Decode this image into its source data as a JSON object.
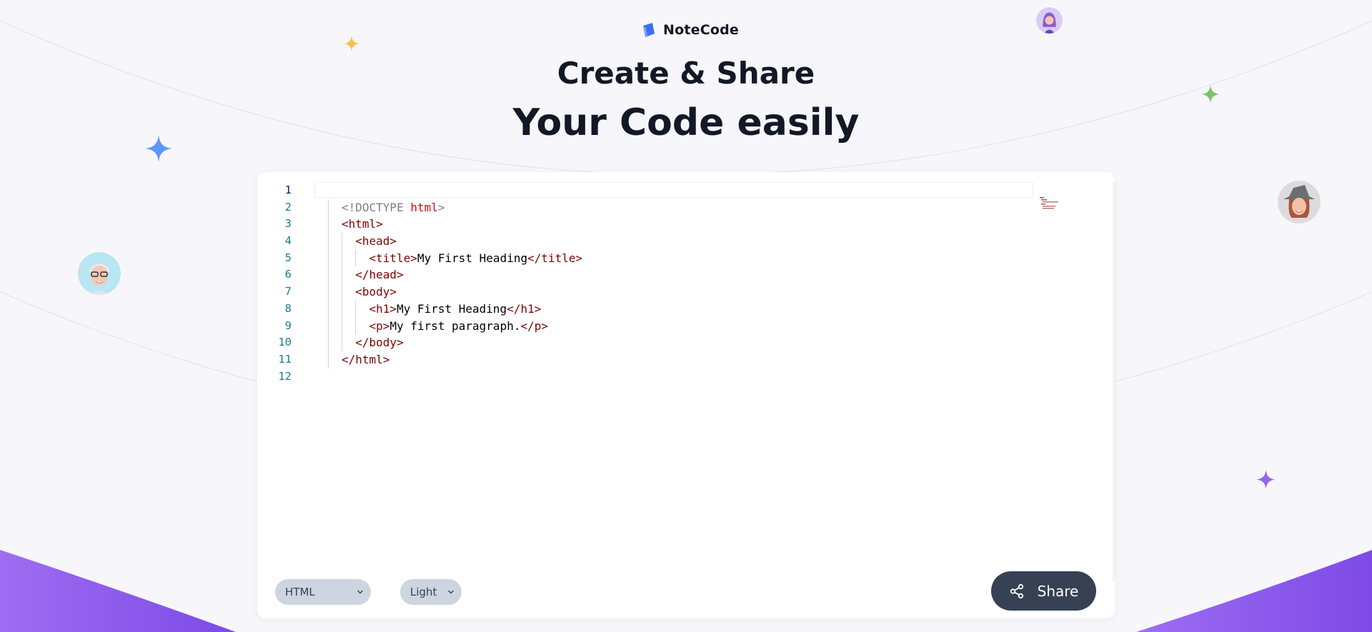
{
  "app": {
    "logo_text": "NoteCode"
  },
  "hero": {
    "line1": "Create & Share",
    "line2": "Your Code easily"
  },
  "editor": {
    "line_numbers": [
      "1",
      "2",
      "3",
      "4",
      "5",
      "6",
      "7",
      "8",
      "9",
      "10",
      "11",
      "12"
    ],
    "active_line": "1",
    "code": {
      "doctype_open": "<!DOCTYPE",
      "doctype_kw": "html",
      "doctype_close": ">",
      "html_open": "<html>",
      "head_open": "<head>",
      "title_open": "<title>",
      "title_text": "My First Heading",
      "title_close": "</title>",
      "head_close": "</head>",
      "body_open": "<body>",
      "h1_open": "<h1>",
      "h1_text": "My First Heading",
      "h1_close": "</h1>",
      "p_open": "<p>",
      "p_text": "My first paragraph.",
      "p_close": "</p>",
      "body_close": "</body>",
      "html_close": "</html>"
    }
  },
  "controls": {
    "language_selected": "HTML",
    "theme_selected": "Light",
    "share_label": "Share"
  },
  "icons": {
    "logo": "notecode-logo-icon",
    "share": "share-icon",
    "chevron": "chevron-down-icon"
  },
  "colors": {
    "background": "#f7f7fb",
    "text_dark": "#121826",
    "select_bg": "#cdd5e0",
    "share_bg": "#364153",
    "accent_purple": "#8a5cf0",
    "sparkle_blue": "#5b97f7",
    "sparkle_yellow": "#f7c14e",
    "sparkle_green": "#7bc46b",
    "sparkle_purple": "#9a62f0"
  }
}
